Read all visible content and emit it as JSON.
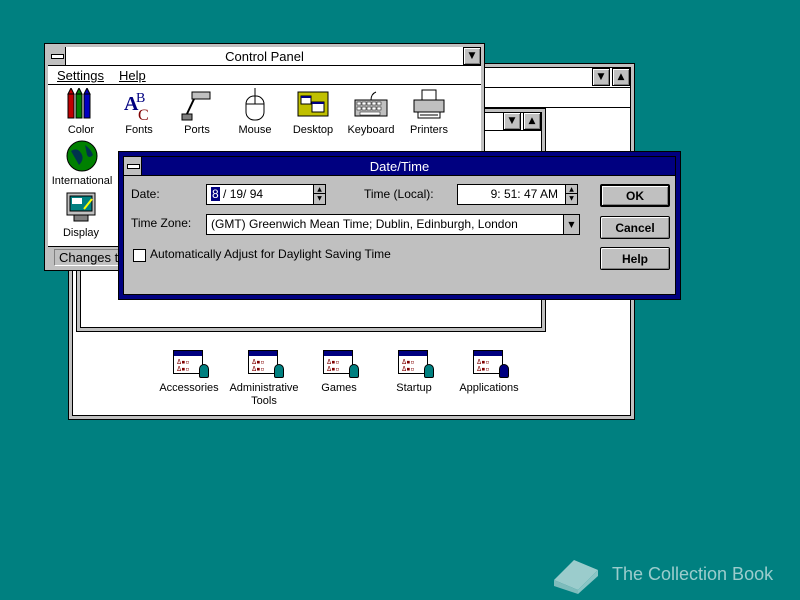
{
  "program_manager": {
    "groups": [
      {
        "label": "Accessories"
      },
      {
        "label": "Administrative\nTools"
      },
      {
        "label": "Games"
      },
      {
        "label": "Startup"
      },
      {
        "label": "Applications"
      }
    ]
  },
  "control_panel": {
    "title": "Control Panel",
    "menu": [
      "Settings",
      "Help"
    ],
    "icons": [
      {
        "label": "Color",
        "icon": "color-icon"
      },
      {
        "label": "Fonts",
        "icon": "fonts-icon"
      },
      {
        "label": "Ports",
        "icon": "ports-icon"
      },
      {
        "label": "Mouse",
        "icon": "mouse-icon"
      },
      {
        "label": "Desktop",
        "icon": "desktop-icon"
      },
      {
        "label": "Keyboard",
        "icon": "keyboard-icon"
      },
      {
        "label": "Printers",
        "icon": "printer-icon"
      },
      {
        "label": "International",
        "icon": "globe-icon"
      },
      {
        "label": "Display",
        "icon": "display-icon"
      }
    ],
    "status": "Changes t"
  },
  "datetime_dialog": {
    "title": "Date/Time",
    "date_label": "Date:",
    "date_month": "8",
    "date_rest": " / 19/ 94",
    "time_label": "Time (Local):",
    "time_value": "9: 51: 47 AM",
    "timezone_label": "Time Zone:",
    "timezone_value": "(GMT) Greenwich Mean Time; Dublin, Edinburgh, London",
    "dst_label": "Automatically Adjust for Daylight Saving Time",
    "dst_checked": false,
    "ok_label": "OK",
    "cancel_label": "Cancel",
    "help_label": "Help"
  },
  "watermark": {
    "text": "The Collection Book"
  },
  "colors": {
    "desktop": "#008080",
    "title_active": "#000080",
    "face": "#c0c0c0"
  }
}
